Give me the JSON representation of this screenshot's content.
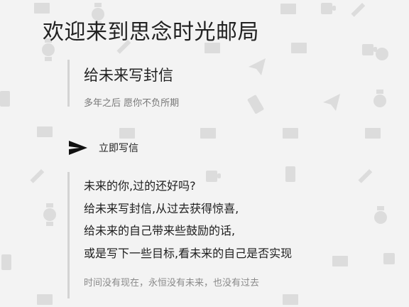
{
  "header": {
    "title": "欢迎来到思念时光邮局"
  },
  "intro": {
    "heading": "给未来写封信",
    "subtitle": "多年之后 愿你不负所期"
  },
  "write_action": {
    "icon": "send-icon",
    "label": "立即写信"
  },
  "quote": {
    "lines": [
      "未来的你,过的还好吗?",
      "给未来写封信,从过去获得惊喜,",
      "给未来的自己带来些鼓励的话,",
      "或是写下一些目标,看未来的自己是否实现"
    ],
    "note": "时间没有现在，永恒没有未来，也没有过去"
  },
  "background": {
    "pattern_icons": [
      "envelope-icon",
      "watch-icon",
      "pencil-icon",
      "phone-icon",
      "paper-plane-icon",
      "cup-icon"
    ],
    "pattern_color": "#dcdcdc"
  }
}
